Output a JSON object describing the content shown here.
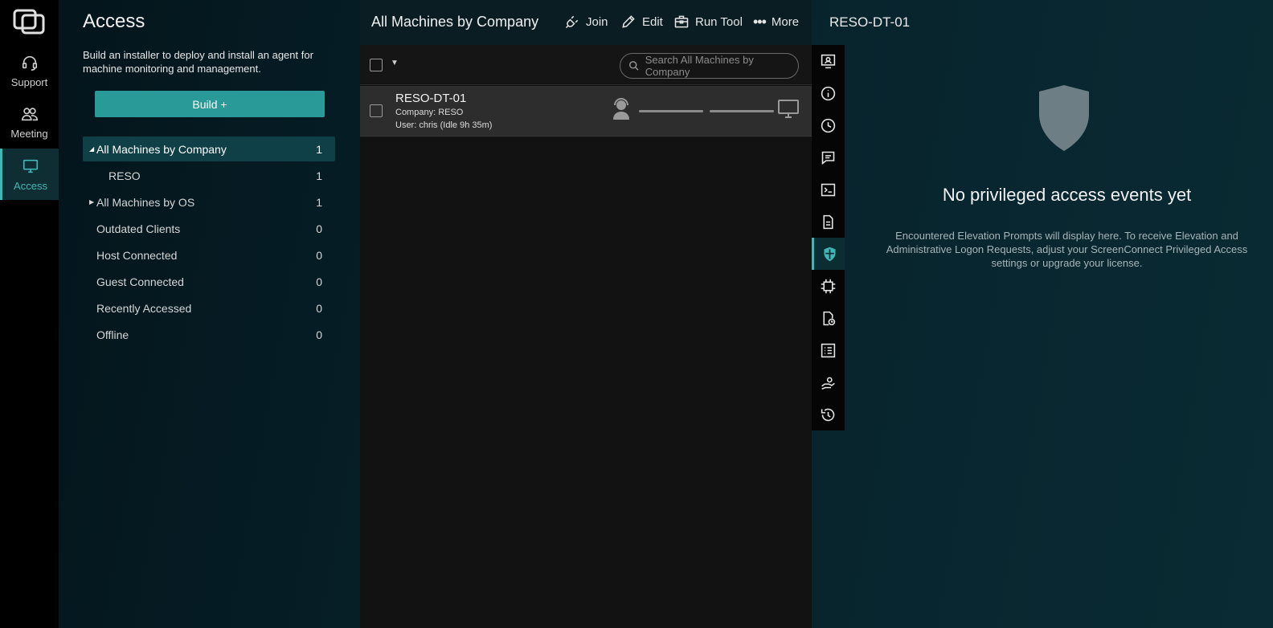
{
  "nav": {
    "items": [
      {
        "label": "Support",
        "icon": "headset-icon"
      },
      {
        "label": "Meeting",
        "icon": "people-icon"
      },
      {
        "label": "Access",
        "icon": "monitor-icon",
        "active": true
      }
    ]
  },
  "access": {
    "title": "Access",
    "description": "Build an installer to deploy and install an agent for machine monitoring and management.",
    "build_label": "Build +",
    "groups": [
      {
        "label": "All Machines by Company",
        "count": "1",
        "expanded": true,
        "selected": true
      },
      {
        "label": "RESO",
        "count": "1",
        "sub": true
      },
      {
        "label": "All Machines by OS",
        "count": "1",
        "expanded": false
      },
      {
        "label": "Outdated Clients",
        "count": "0"
      },
      {
        "label": "Host Connected",
        "count": "0"
      },
      {
        "label": "Guest Connected",
        "count": "0"
      },
      {
        "label": "Recently Accessed",
        "count": "0"
      },
      {
        "label": "Offline",
        "count": "0"
      }
    ]
  },
  "list": {
    "title": "All Machines by Company",
    "actions": {
      "join": "Join",
      "edit": "Edit",
      "run_tool": "Run Tool",
      "more": "More"
    },
    "search_placeholder": "Search All Machines by Company",
    "machine": {
      "name": "RESO-DT-01",
      "company": "Company: RESO",
      "user": "User: chris (Idle 9h 35m)"
    }
  },
  "detail": {
    "title": "RESO-DT-01",
    "heading": "No privileged access events yet",
    "description": "Encountered Elevation Prompts will display here. To receive Elevation and Administrative Logon Requests, adjust your ScreenConnect Privileged Access settings or upgrade your license."
  },
  "colors": {
    "accent": "#3fb7b7",
    "build_button": "#2a9a98",
    "selected_group": "#0f4048"
  }
}
